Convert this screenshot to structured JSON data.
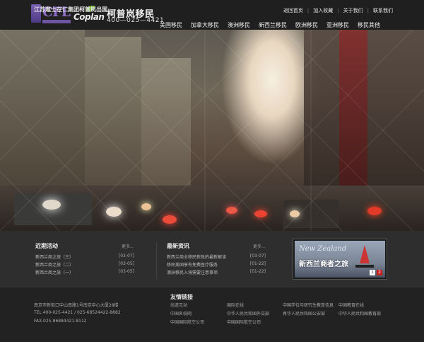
{
  "header": {
    "logo_cfl_text": "CFL",
    "logo_cfl_sub": "江苏遨士在仁集团",
    "logo_coplan_text": "Coplan",
    "logo_coplan_sub": "",
    "brand_name": "柯普岚移民",
    "brand_phone": "400—025—4421",
    "top_links": [
      "返回首页",
      "加入收藏",
      "关于我们",
      "联系我们"
    ],
    "nav": [
      "美国移民",
      "加拿大移民",
      "澳洲移民",
      "新西兰移民",
      "欧洲移民",
      "亚洲移民",
      "移民其他"
    ]
  },
  "news": {
    "recent": {
      "title": "近期活动",
      "more": "更多...",
      "items": [
        {
          "title": "新西兰商之旅（三）",
          "date": "[03-07]"
        },
        {
          "title": "新西兰商之旅（二）",
          "date": "[03-05]"
        },
        {
          "title": "新西兰商之旅（一）",
          "date": "[03-05]"
        }
      ]
    },
    "latest": {
      "title": "最新资讯",
      "more": "更多...",
      "items": [
        {
          "title": "新西兰商业移民新政的最新解读",
          "date": "[03-07]"
        },
        {
          "title": "移民美国享有免费医疗服务",
          "date": "[01-22]"
        },
        {
          "title": "澳洲移民入境需要注意事项",
          "date": "[01-22]"
        }
      ]
    },
    "promo": {
      "script": "New Zealand",
      "title": "新西兰商者之旅",
      "pages": [
        "1",
        "2"
      ]
    }
  },
  "footer": {
    "company": "江苏遨士在仁集团柯普岚出国",
    "address": "南京市新街口中山南路1号南京中心大厦28楼",
    "tel": "TEL 400-025-4421 / 025-68524422-8882",
    "fax": "FAX.025-86884421-8112",
    "links_title": "友情链接",
    "links": [
      "尚道互动",
      "国际在线",
      "中国学位与研究生教育信息",
      "中国教育在线",
      "中国名校网",
      "中华人民共和国外交部",
      "再华人民共和国公安部",
      "中华人民共和国教育部",
      "中国国际航空公司",
      "中国国际航空公司"
    ]
  },
  "colors": {
    "header_bg": "#1f1f1f",
    "news_bg": "#2e2e2e",
    "footer_bg": "#222222",
    "accent_red": "#c62020",
    "logo_purple": "#8e6cc6",
    "logo_green": "#7bb83a"
  }
}
